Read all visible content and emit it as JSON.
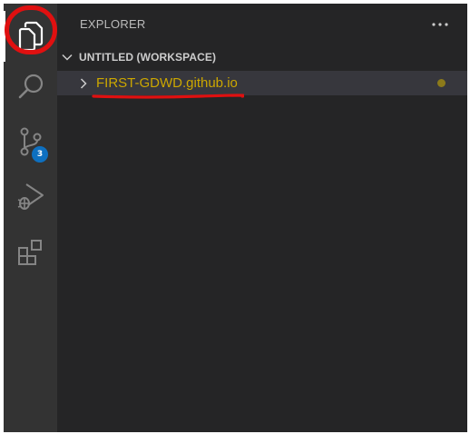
{
  "activity_bar": {
    "items": [
      {
        "name": "explorer",
        "icon": "files-icon",
        "active": true
      },
      {
        "name": "search",
        "icon": "search-icon",
        "active": false
      },
      {
        "name": "source-control",
        "icon": "source-control-icon",
        "active": false,
        "badge": "3"
      },
      {
        "name": "run-and-debug",
        "icon": "run-debug-icon",
        "active": false
      },
      {
        "name": "extensions",
        "icon": "extensions-icon",
        "active": false
      }
    ]
  },
  "sidebar": {
    "title": "EXPLORER",
    "more_actions_icon": "ellipsis-icon",
    "section": {
      "title": "UNTITLED (WORKSPACE)",
      "expanded": true
    },
    "folder": {
      "label": "FIRST-GDWD.github.io",
      "expanded": false,
      "modified": true
    }
  },
  "annotations": {
    "circle_color": "#e01010",
    "underline_color": "#e01010"
  },
  "colors": {
    "activity_bar_bg": "#333333",
    "sidebar_bg": "#252526",
    "selected_row_bg": "#37373d",
    "folder_text": "#cca700",
    "badge_bg": "#0e70c0",
    "icon": "#858585",
    "icon_active": "#ffffff"
  }
}
